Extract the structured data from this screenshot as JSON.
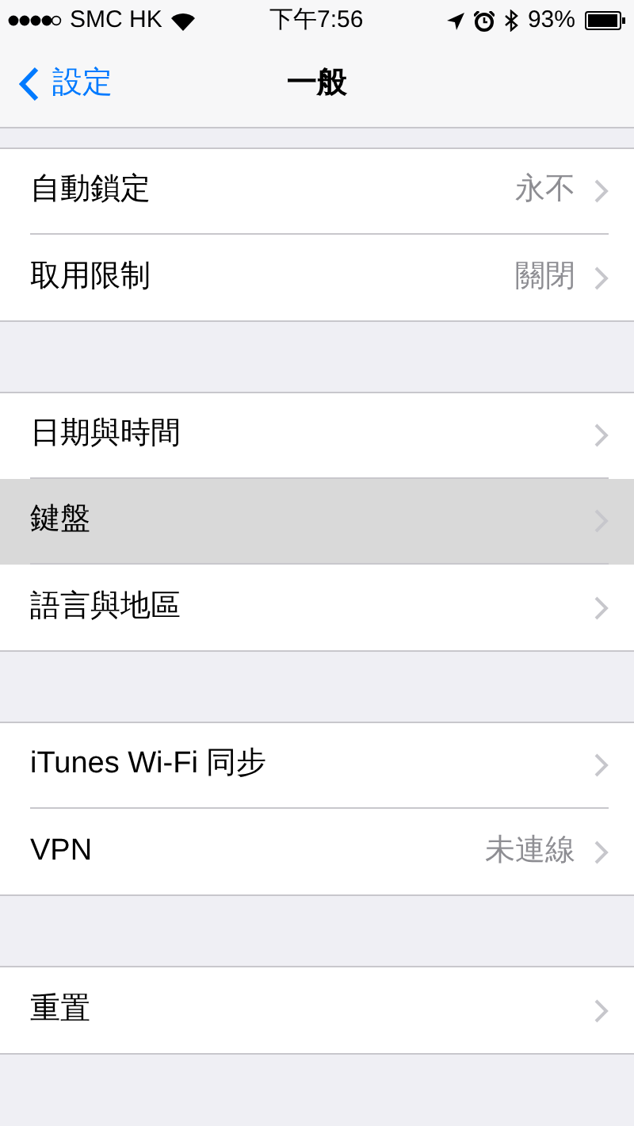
{
  "status_bar": {
    "carrier": "SMC HK",
    "time": "下午7:56",
    "battery": "93%"
  },
  "nav": {
    "back": "設定",
    "title": "一般"
  },
  "groups": [
    {
      "rows": [
        {
          "label": "自動鎖定",
          "value": "永不",
          "selected": false
        },
        {
          "label": "取用限制",
          "value": "關閉",
          "selected": false
        }
      ]
    },
    {
      "rows": [
        {
          "label": "日期與時間",
          "selected": false
        },
        {
          "label": "鍵盤",
          "selected": true
        },
        {
          "label": "語言與地區",
          "selected": false
        }
      ]
    },
    {
      "rows": [
        {
          "label": "iTunes Wi-Fi 同步",
          "selected": false
        },
        {
          "label": "VPN",
          "value": "未連線",
          "selected": false
        }
      ]
    },
    {
      "rows": [
        {
          "label": "重置",
          "selected": false
        }
      ]
    }
  ]
}
